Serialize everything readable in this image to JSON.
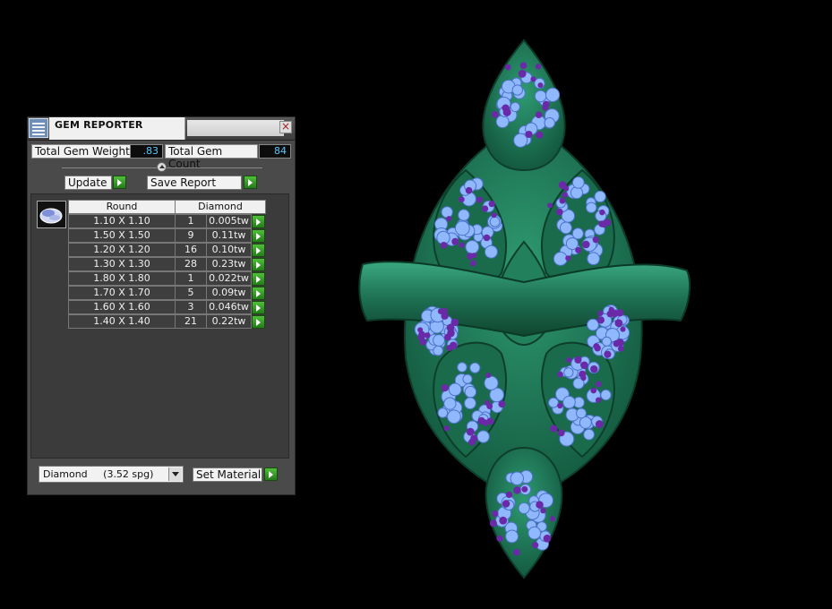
{
  "panel": {
    "title": "GEM REPORTER",
    "close_symbol": "×",
    "total_weight_label": "Total Gem Weight",
    "total_weight_value": ".83",
    "total_count_label": "Total Gem Count",
    "total_count_value": "84",
    "update_label": "Update",
    "save_report_label": "Save Report",
    "table": {
      "headers": [
        "Round",
        "Diamond"
      ],
      "rows": [
        {
          "size": "1.10 X 1.10",
          "count": "1",
          "weight": "0.005tw"
        },
        {
          "size": "1.50 X 1.50",
          "count": "9",
          "weight": "0.11tw"
        },
        {
          "size": "1.20 X 1.20",
          "count": "16",
          "weight": "0.10tw"
        },
        {
          "size": "1.30 X 1.30",
          "count": "28",
          "weight": "0.23tw"
        },
        {
          "size": "1.80 X 1.80",
          "count": "1",
          "weight": "0.022tw"
        },
        {
          "size": "1.70 X 1.70",
          "count": "5",
          "weight": "0.09tw"
        },
        {
          "size": "1.60 X 1.60",
          "count": "3",
          "weight": "0.046tw"
        },
        {
          "size": "1.40 X 1.40",
          "count": "21",
          "weight": "0.22tw"
        }
      ]
    },
    "material_select": "Diamond     (3.52 spg)",
    "set_material_label": "Set Material"
  },
  "colors": {
    "metal": "#1f7a5a",
    "gem_blue": "#8fb8ff",
    "gem_purple": "#6a2aa8",
    "go_button": "#34a028"
  },
  "icons": {
    "title": "gem-reporter-icon",
    "close": "close-icon",
    "slider": "slider-knob-icon",
    "go": "green-arrow-icon",
    "gem": "round-gem-icon",
    "dropdown": "chevron-down-icon"
  }
}
